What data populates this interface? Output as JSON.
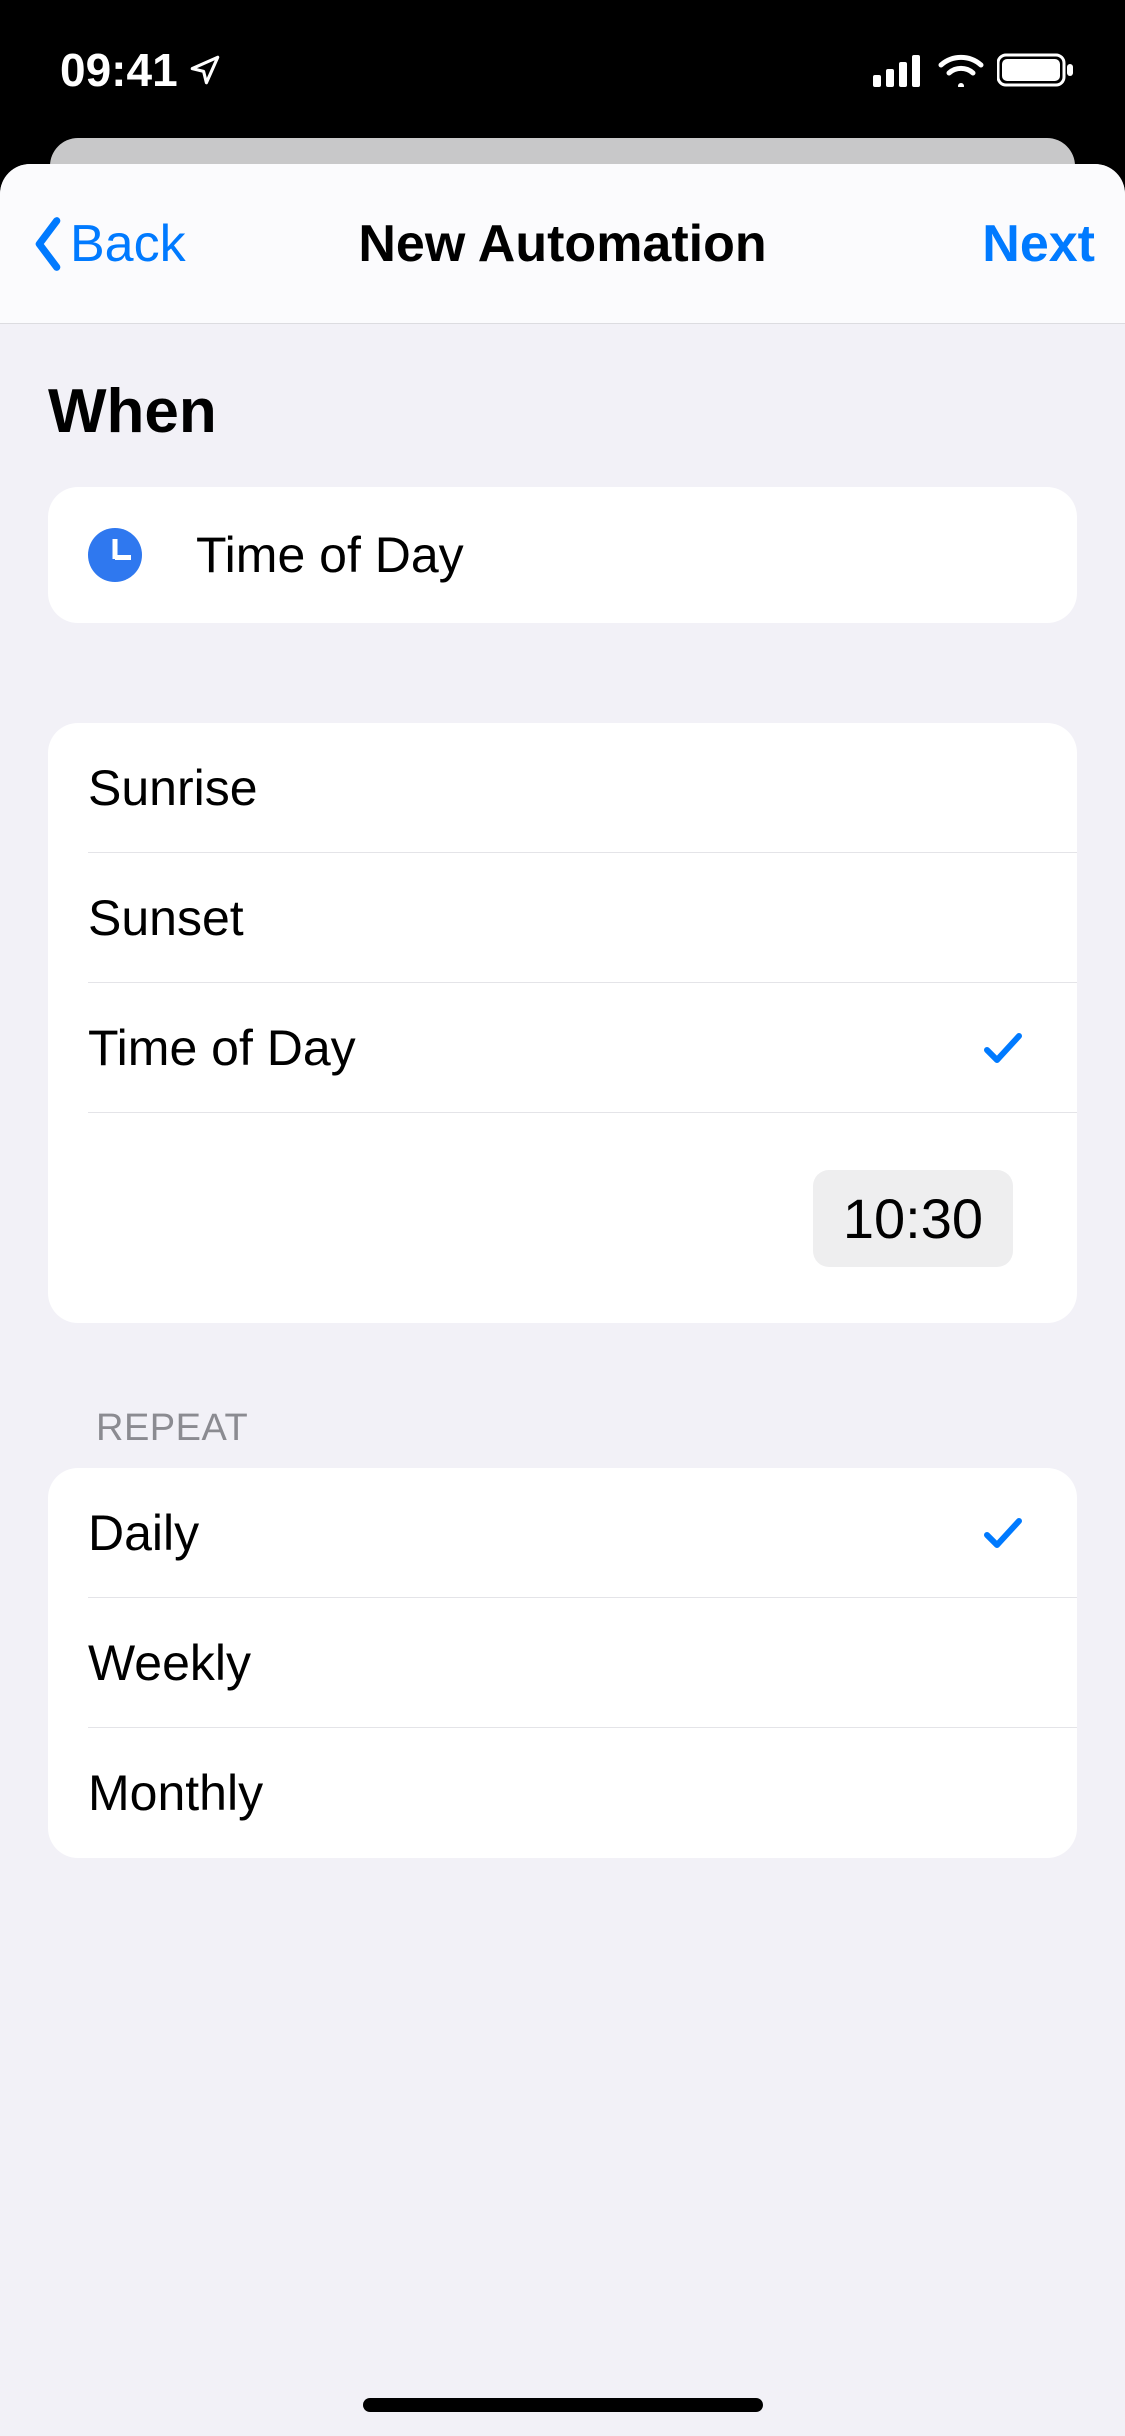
{
  "status": {
    "time": "09:41"
  },
  "nav": {
    "back": "Back",
    "title": "New Automation",
    "next": "Next"
  },
  "when": {
    "heading": "When",
    "trigger_label": "Time of Day",
    "options": {
      "sunrise": "Sunrise",
      "sunset": "Sunset",
      "time_of_day": "Time of Day"
    },
    "selected_time": "10:30"
  },
  "repeat": {
    "header": "REPEAT",
    "options": {
      "daily": "Daily",
      "weekly": "Weekly",
      "monthly": "Monthly"
    }
  }
}
